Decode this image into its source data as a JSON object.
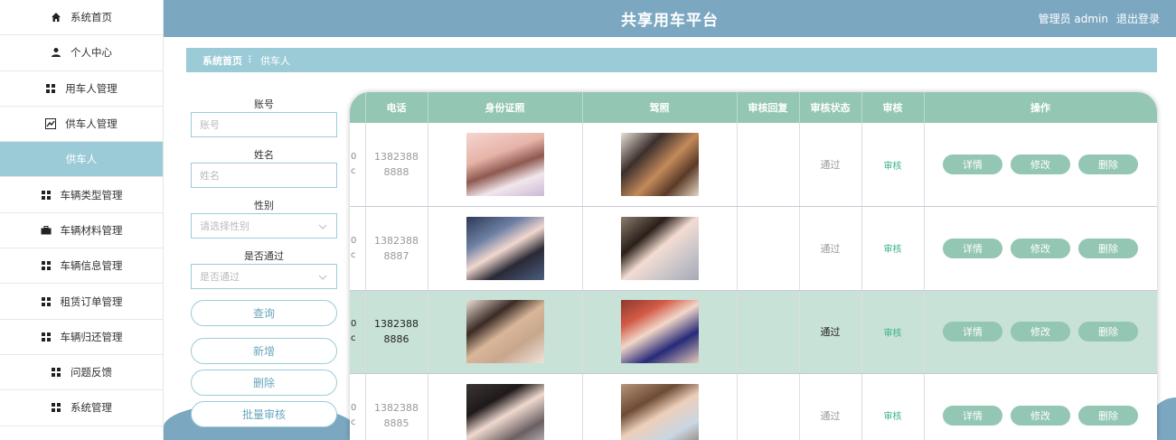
{
  "header": {
    "title": "共享用车平台",
    "user": "管理员 admin",
    "logout": "退出登录"
  },
  "sidebar": {
    "items": [
      {
        "label": "系统首页",
        "icon": "home-icon"
      },
      {
        "label": "个人中心",
        "icon": "person-icon"
      },
      {
        "label": "用车人管理",
        "icon": "grid-icon"
      },
      {
        "label": "供车人管理",
        "icon": "chart-icon"
      },
      {
        "label": "供车人",
        "icon": ""
      },
      {
        "label": "车辆类型管理",
        "icon": "grid-icon"
      },
      {
        "label": "车辆材料管理",
        "icon": "briefcase-icon"
      },
      {
        "label": "车辆信息管理",
        "icon": "grid-icon"
      },
      {
        "label": "租赁订单管理",
        "icon": "grid-icon"
      },
      {
        "label": "车辆归还管理",
        "icon": "grid-icon"
      },
      {
        "label": "问题反馈",
        "icon": "grid-icon"
      },
      {
        "label": "系统管理",
        "icon": "grid-icon"
      }
    ]
  },
  "breadcrumb": {
    "home": "系统首页",
    "sep": "⠇",
    "current": "供车人"
  },
  "search": {
    "account_label": "账号",
    "account_placeholder": "账号",
    "name_label": "姓名",
    "name_placeholder": "姓名",
    "gender_label": "性别",
    "gender_placeholder": "请选择性别",
    "passed_label": "是否通过",
    "passed_placeholder": "是否通过",
    "query_btn": "查询",
    "add_btn": "新增",
    "delete_btn": "删除",
    "batch_btn": "批量审核"
  },
  "table": {
    "headers": [
      "",
      "电话",
      "身份证照",
      "驾照",
      "审核回复",
      "审核状态",
      "审核",
      "操作"
    ],
    "rows": [
      {
        "cut_a": "0",
        "cut_b": "c",
        "phone_a": "1382388",
        "phone_b": "8888",
        "reply": "",
        "status": "通过",
        "review": "审核"
      },
      {
        "cut_a": "0",
        "cut_b": "c",
        "phone_a": "1382388",
        "phone_b": "8887",
        "reply": "",
        "status": "通过",
        "review": "审核"
      },
      {
        "cut_a": "0",
        "cut_b": "c",
        "phone_a": "1382388",
        "phone_b": "8886",
        "reply": "",
        "status": "通过",
        "review": "审核"
      },
      {
        "cut_a": "0",
        "cut_b": "c",
        "phone_a": "1382388",
        "phone_b": "8885",
        "reply": "",
        "status": "通过",
        "review": "审核"
      }
    ],
    "ops": {
      "detail": "详情",
      "edit": "修改",
      "delete": "删除"
    }
  },
  "colors": {
    "header": "#7ba7c1",
    "accent": "#9ccbd8",
    "table_head": "#93c6b3",
    "selected_row": "#c8e2d8"
  }
}
